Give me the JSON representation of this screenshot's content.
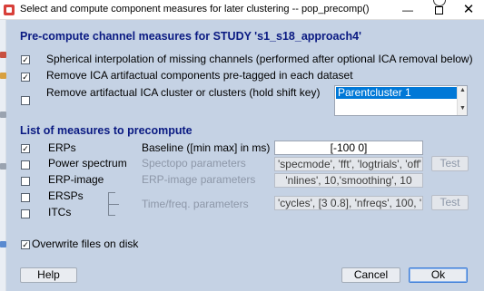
{
  "window": {
    "title": "Select and compute component measures for later clustering -- pop_precomp()",
    "minimize_glyph": "—",
    "close_glyph": "✕"
  },
  "precompute": {
    "heading": "Pre-compute channel measures for STUDY 's1_s18_approach4'",
    "options": [
      {
        "label": "Spherical interpolation of missing channels (performed after optional ICA removal below)",
        "checked": true
      },
      {
        "label": "Remove ICA artifactual components pre-tagged in each dataset",
        "checked": true
      },
      {
        "label": "Remove artifactual ICA cluster or clusters (hold shift key)",
        "checked": false
      }
    ],
    "cluster_list": {
      "items": [
        "Parentcluster 1"
      ],
      "selected": "Parentcluster 1"
    }
  },
  "measures": {
    "heading": "List of measures to precompute",
    "rows": [
      {
        "name": "ERPs",
        "checked": true,
        "param_label": "Baseline ([min max] in ms)",
        "param_enabled": true,
        "value": "[-100 0]",
        "has_test": false
      },
      {
        "name": "Power spectrum",
        "checked": false,
        "param_label": "Spectopo parameters",
        "param_enabled": false,
        "value": "'specmode', 'fft', 'logtrials', 'off'",
        "has_test": true,
        "test_label": "Test"
      },
      {
        "name": "ERP-image",
        "checked": false,
        "param_label": "ERP-image parameters",
        "param_enabled": false,
        "value": "'nlines', 10,'smoothing', 10",
        "has_test": false
      },
      {
        "name": "ERSPs",
        "checked": false
      },
      {
        "name": "ITCs",
        "checked": false
      }
    ],
    "timefreq": {
      "label": "Time/freq. parameters",
      "value": "'cycles', [3 0.8], 'nfreqs', 100, 'ntimes",
      "test_label": "Test"
    }
  },
  "overwrite": {
    "label": "Overwrite files on disk",
    "checked": true
  },
  "buttons": {
    "help": "Help",
    "cancel": "Cancel",
    "ok": "Ok"
  },
  "colors": {
    "heading": "#0a1a82",
    "background": "#c5d2e4",
    "selection": "#0078d7",
    "disabled_text": "#8d97a8"
  }
}
